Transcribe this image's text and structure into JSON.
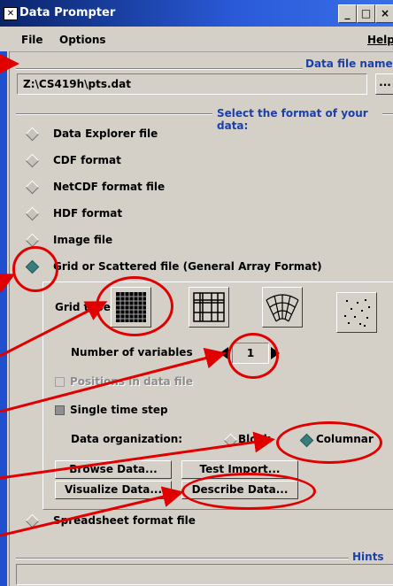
{
  "window": {
    "title": "Data Prompter",
    "minimize": "_",
    "maximize": "□",
    "close": "×"
  },
  "menubar": {
    "file": "File",
    "options": "Options",
    "help": "Help"
  },
  "datafile": {
    "header": "Data file name",
    "path": "Z:\\CS419h\\pts.dat",
    "browse_label": "..."
  },
  "format": {
    "header": "Select the format of your data:",
    "options": [
      {
        "label": "Data Explorer file",
        "selected": false
      },
      {
        "label": "CDF format",
        "selected": false
      },
      {
        "label": "NetCDF format file",
        "selected": false
      },
      {
        "label": "HDF format",
        "selected": false
      },
      {
        "label": "Image file",
        "selected": false
      },
      {
        "label": "Grid or Scattered file (General Array Format)",
        "selected": true
      }
    ],
    "spreadsheet": {
      "label": "Spreadsheet format file",
      "selected": false
    }
  },
  "grid": {
    "type_label": "Grid type",
    "types": [
      "regular-grid-icon",
      "deformed-grid-icon",
      "warped-grid-icon",
      "scattered-points-icon"
    ],
    "selected_type": 0,
    "num_vars_label": "Number of variables",
    "num_vars_value": "1",
    "positions_label": "Positions in data file",
    "single_time_label": "Single time step",
    "org_label": "Data organization:",
    "block_label": "Block",
    "columnar_label": "Columnar",
    "organization": "Columnar"
  },
  "buttons": {
    "browse": "Browse Data...",
    "test": "Test Import...",
    "visualize": "Visualize Data...",
    "describe": "Describe Data..."
  },
  "hints": {
    "header": "Hints"
  },
  "colors": {
    "accent": "#1c3fa8",
    "annotation": "#e00000",
    "selected_radio": "#3b7c7c"
  }
}
